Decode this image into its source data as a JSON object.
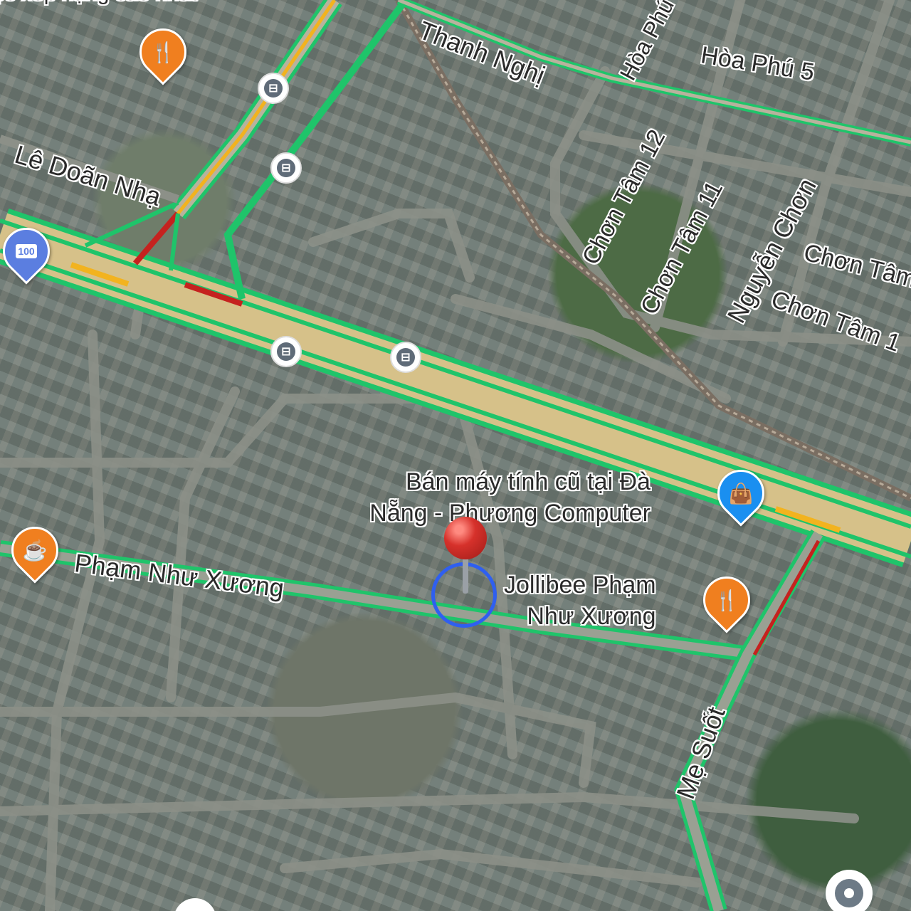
{
  "map": {
    "roads": {
      "le_doan_nha": "Lê Doãn Nhạ",
      "thanh_nghi": "Thanh Nghị",
      "hoa_phu": "Hòa Phú",
      "hoa_phu_5": "Hòa Phú 5",
      "chon_tam_12": "Chơn Tâm 12",
      "chon_tam_11": "Chơn Tâm 11",
      "nguyen_chon": "Nguyễn Chơn",
      "chon_tam": "Chơn Tâm",
      "chon_tam_1": "Chơn Tâm 1",
      "pham_nhu_xuong": "Phạm Như Xương",
      "me_suot": "Mẹ Suốt",
      "top_partial": "ộc xếp hạng cao nhất"
    },
    "places": {
      "computer_shop_line1": "Bán máy tính cũ tại Đà",
      "computer_shop_line2": "Nẵng - Phương Computer",
      "jollibee_line1": "Jollibee Phạm",
      "jollibee_line2": "Như Xương"
    },
    "icons": {
      "restaurant": "restaurant-icon",
      "cafe": "cafe-icon",
      "shopping": "shopping-bag-icon",
      "bus": "bus-stop-icon",
      "atm": "atm-icon",
      "pin": "dropped-pin-icon"
    },
    "colors": {
      "traffic_green": "#1fc46a",
      "traffic_yellow": "#f2b31f",
      "traffic_red": "#c5221f",
      "poi_orange": "#f07f1f",
      "poi_blue": "#1a8ff0",
      "pin_red": "#d6312b",
      "location_ring": "#2f5ff0"
    },
    "atm_label": "100"
  }
}
